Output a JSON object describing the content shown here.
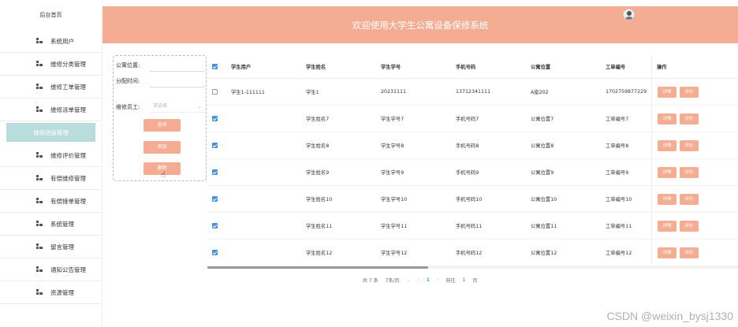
{
  "sidebar": {
    "home": "后台首页",
    "items": [
      {
        "label": "系统用户"
      },
      {
        "label": "维修分类管理"
      },
      {
        "label": "维修工单管理"
      },
      {
        "label": "维修派单管理"
      },
      {
        "label": "维修进度管理"
      },
      {
        "label": "维修评价管理"
      },
      {
        "label": "有偿维修管理"
      },
      {
        "label": "有偿接单管理"
      },
      {
        "label": "系统管理"
      },
      {
        "label": "留言管理"
      },
      {
        "label": "通知公告管理"
      },
      {
        "label": "资源管理"
      }
    ],
    "active_index": 4
  },
  "header": {
    "title": "欢迎使用大学生公寓设备保修系统"
  },
  "search": {
    "location_label": "公寓位置:",
    "time_label": "分配时间:",
    "worker_label": "维修员工:",
    "worker_placeholder": "请选择",
    "query_btn": "查询",
    "add_btn": "添加",
    "delete_btn": "删除"
  },
  "table": {
    "headers": [
      "学生用户",
      "学生姓名",
      "学生学号",
      "手机号码",
      "公寓位置",
      "工单编号",
      "操作"
    ],
    "rows": [
      {
        "checked": false,
        "cells": [
          "学生1-111111",
          "学生1",
          "20231111",
          "13712341111",
          "A座202",
          "1702759877229"
        ]
      },
      {
        "checked": true,
        "cells": [
          "",
          "学生姓名7",
          "学生学号7",
          "手机号码7",
          "公寓位置7",
          "工单编号7"
        ]
      },
      {
        "checked": true,
        "cells": [
          "",
          "学生姓名8",
          "学生学号8",
          "手机号码8",
          "公寓位置8",
          "工单编号8"
        ]
      },
      {
        "checked": true,
        "cells": [
          "",
          "学生姓名9",
          "学生学号9",
          "手机号码9",
          "公寓位置9",
          "工单编号9"
        ]
      },
      {
        "checked": true,
        "cells": [
          "",
          "学生姓名10",
          "学生学号10",
          "手机号码10",
          "公寓位置10",
          "工单编号10"
        ]
      },
      {
        "checked": true,
        "cells": [
          "",
          "学生姓名11",
          "学生学号11",
          "手机号码11",
          "公寓位置11",
          "工单编号11"
        ]
      },
      {
        "checked": true,
        "cells": [
          "",
          "学生姓名12",
          "学生学号12",
          "手机号码12",
          "公寓位置12",
          "工单编号12"
        ]
      }
    ],
    "detail_btn": "详情",
    "rate_btn": "评价"
  },
  "pager": {
    "total": "共 7 条",
    "page_size": "7条/页",
    "current": "1",
    "goto_label": "前往",
    "goto_value": "1",
    "page_unit": "页"
  },
  "watermark": "CSDN @weixin_bysj1330",
  "colors": {
    "accent": "#f4ad93",
    "active_menu": "#b9dcdc",
    "checkbox": "#4a90d9"
  }
}
